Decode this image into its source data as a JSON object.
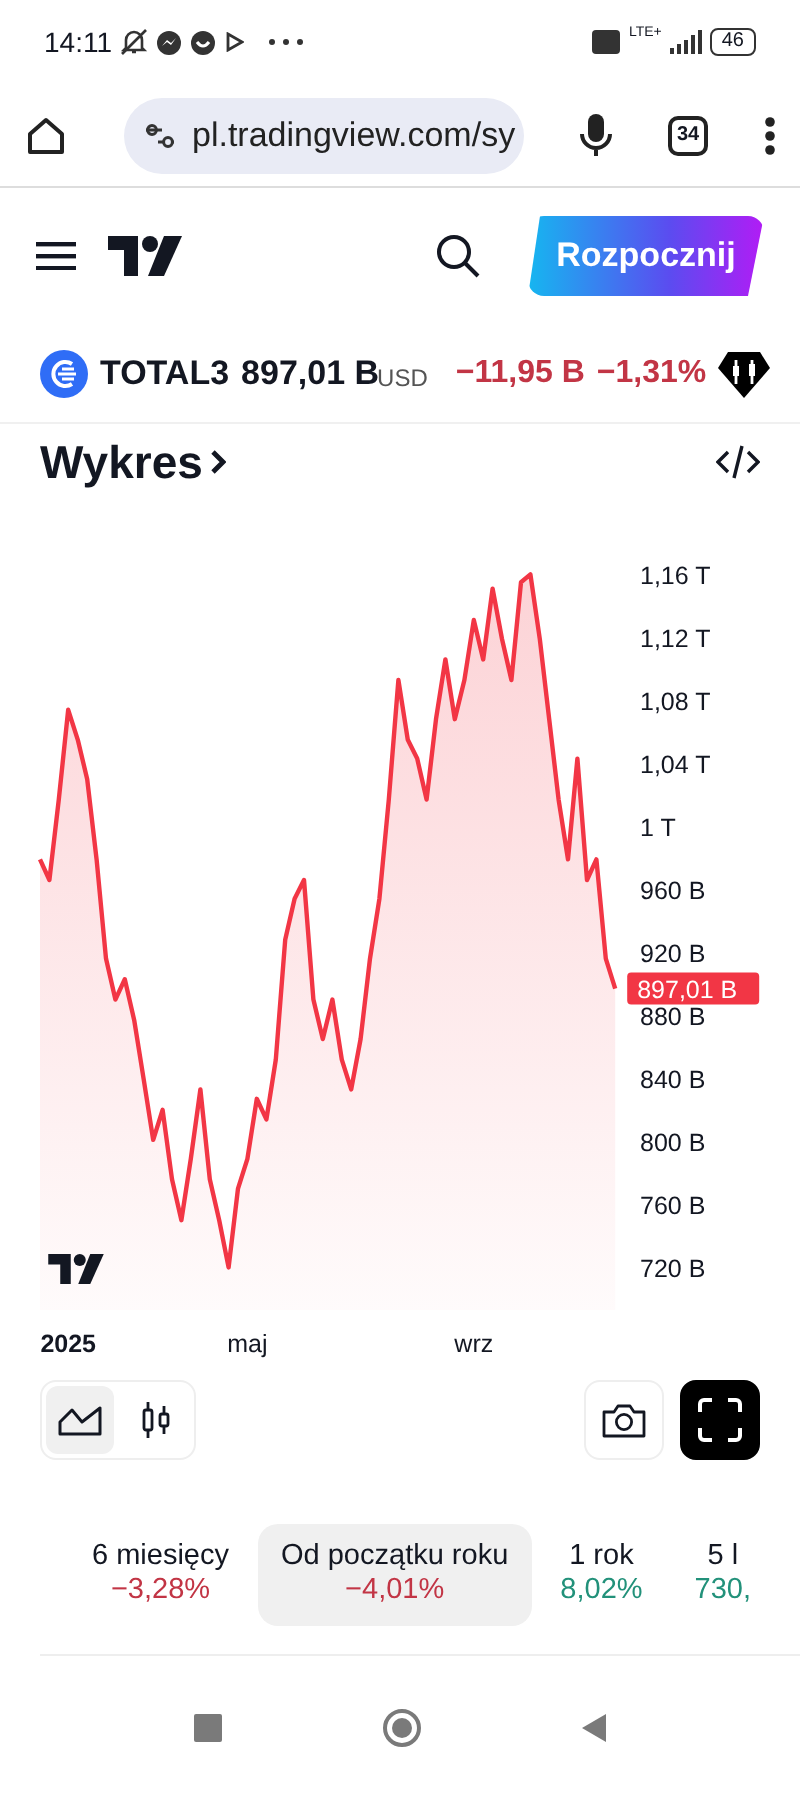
{
  "status_bar": {
    "time": "14:11",
    "network": "LTE+",
    "battery": "46"
  },
  "browser": {
    "url": "pl.tradingview.com/sy",
    "tab_count": "34"
  },
  "header": {
    "cta": "Rozpocznij"
  },
  "ticker": {
    "symbol": "TOTAL3",
    "price": "897,01 B",
    "currency": "USD",
    "change": "−11,95 B",
    "change_percent": "−1,31%"
  },
  "chart_section": {
    "title": "Wykres",
    "chart_data": {
      "type": "area",
      "categories": [
        null,
        null,
        null,
        "2025",
        null,
        null,
        null,
        null,
        null,
        null,
        null,
        null,
        null,
        null,
        null,
        null,
        null,
        null,
        null,
        null,
        null,
        null,
        "maj",
        null,
        null,
        null,
        null,
        null,
        null,
        null,
        null,
        null,
        null,
        null,
        null,
        null,
        null,
        null,
        null,
        null,
        null,
        null,
        null,
        null,
        null,
        null,
        "wrz",
        null,
        null,
        null,
        null,
        null,
        null,
        null,
        null,
        null,
        null,
        null,
        null,
        null,
        null,
        null
      ],
      "series": [
        {
          "color": "#f23645",
          "values": [
            979000000000,
            966000000000,
            1017000000000,
            1074000000000,
            1055000000000,
            1030000000000,
            979000000000,
            916000000000,
            890000000000,
            903000000000,
            877000000000,
            839000000000,
            801000000000,
            820000000000,
            776000000000,
            750000000000,
            789000000000,
            833000000000,
            776000000000,
            750000000000,
            720000000000,
            770000000000,
            789000000000,
            827000000000,
            814000000000,
            852000000000,
            928000000000,
            954000000000,
            966000000000,
            890000000000,
            865000000000,
            890000000000,
            852000000000,
            833000000000,
            865000000000,
            916000000000,
            954000000000,
            1017000000000,
            1093000000000,
            1055000000000,
            1043000000000,
            1017000000000,
            1068000000000,
            1106000000000,
            1068000000000,
            1093000000000,
            1131000000000,
            1106000000000,
            1151000000000,
            1119000000000,
            1093000000000,
            1155000000000,
            1160000000000,
            1119000000000,
            1068000000000,
            1017000000000,
            979000000000,
            1043000000000,
            966000000000,
            979000000000,
            916000000000,
            897000000000
          ]
        }
      ],
      "ylim": [
        720000000000,
        1160000000000
      ],
      "yticks": [
        {
          "value": 720000000000,
          "label": "720 B"
        },
        {
          "value": 760000000000,
          "label": "760 B"
        },
        {
          "value": 800000000000,
          "label": "800 B"
        },
        {
          "value": 840000000000,
          "label": "840 B"
        },
        {
          "value": 880000000000,
          "label": "880 B"
        },
        {
          "value": 920000000000,
          "label": "920 B"
        },
        {
          "value": 960000000000,
          "label": "960 B"
        },
        {
          "value": 1000000000000,
          "label": "1 T"
        },
        {
          "value": 1040000000000,
          "label": "1,04 T"
        },
        {
          "value": 1080000000000,
          "label": "1,08 T"
        },
        {
          "value": 1120000000000,
          "label": "1,12 T"
        },
        {
          "value": 1160000000000,
          "label": "1,16 T"
        }
      ],
      "annotations": [
        "897,01 B"
      ]
    }
  },
  "chart_styles": [
    {
      "kind": "area",
      "selected": true
    },
    {
      "kind": "candles",
      "selected": false
    }
  ],
  "periods": [
    {
      "label": "6 miesięcy",
      "change": "−3,28%",
      "color": "#c23545",
      "selected": false
    },
    {
      "label": "Od początku roku",
      "change": "−4,01%",
      "color": "#c23545",
      "selected": true
    },
    {
      "label": "1 rok",
      "change": "8,02%",
      "color": "#22917a",
      "selected": false
    },
    {
      "label": "5 l",
      "change": "730,",
      "color": "#22917a",
      "selected": false
    }
  ]
}
